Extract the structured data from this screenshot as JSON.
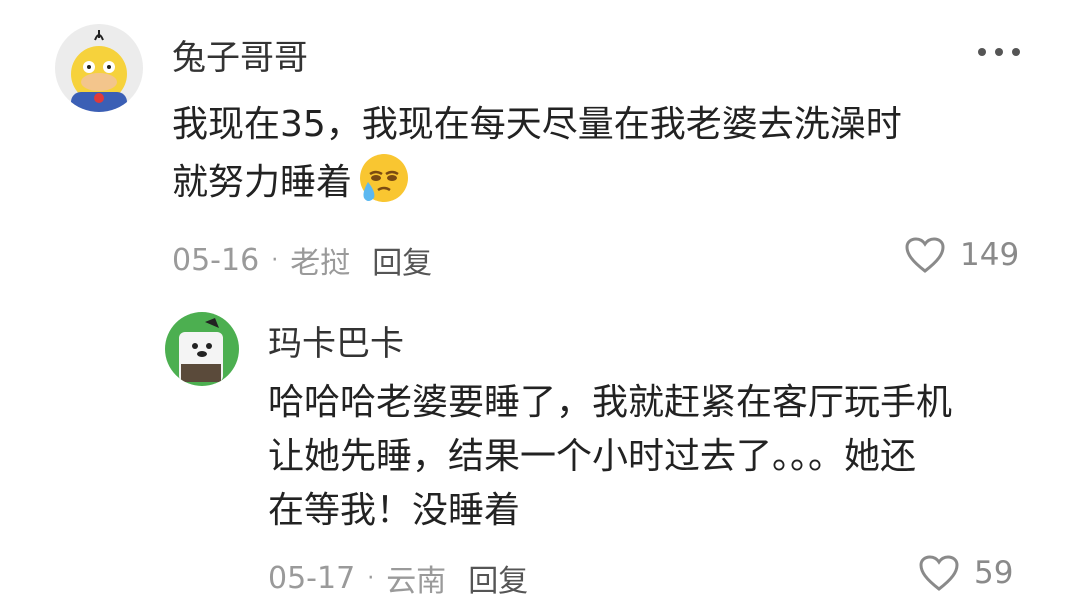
{
  "comments": [
    {
      "username": "兔子哥哥",
      "avatar_icon": "psyduck-avatar-icon",
      "text_lines": [
        "我现在35，我现在每天尽量在我老婆去洗澡时",
        "就努力睡着"
      ],
      "emoji": "crying-face-emoji-icon",
      "date": "05-16",
      "location": "老挝",
      "reply_label": "回复",
      "like_count": "149"
    },
    {
      "username": "玛卡巴卡",
      "avatar_icon": "cartoon-avatar-icon",
      "text_lines": [
        "哈哈哈老婆要睡了，我就赶紧在客厅玩手机",
        "让她先睡，结果一个小时过去了。。。她还",
        "在等我！没睡着"
      ],
      "date": "05-17",
      "location": "云南",
      "reply_label": "回复",
      "like_count": "59"
    }
  ],
  "colors": {
    "username": "#333333",
    "body": "#222222",
    "meta": "#9a9a9a",
    "avatar_bg_1": "#e8e8e8",
    "avatar_bg_2": "#4caf50"
  },
  "icons": {
    "more": "more-dots-icon",
    "like": "heart-outline-icon",
    "separator": "·"
  }
}
